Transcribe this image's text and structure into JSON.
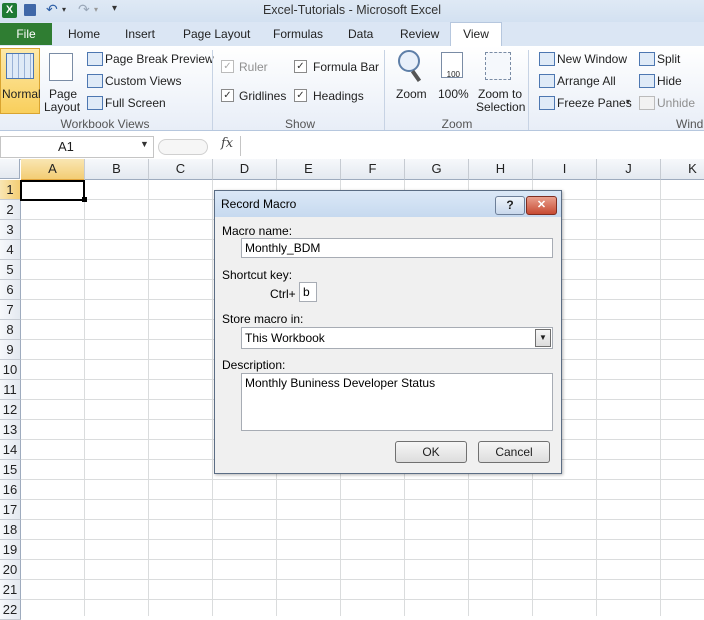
{
  "window": {
    "title": "Excel-Tutorials  -  Microsoft Excel"
  },
  "tabs": [
    "File",
    "Home",
    "Insert",
    "Page Layout",
    "Formulas",
    "Data",
    "Review",
    "View"
  ],
  "ribbon": {
    "workbook_views": {
      "group_label": "Workbook Views",
      "normal": "Normal",
      "page_layout_1": "Page",
      "page_layout_2": "Layout",
      "page_break_preview": "Page Break Preview",
      "custom_views": "Custom Views",
      "full_screen": "Full Screen"
    },
    "show": {
      "group_label": "Show",
      "ruler": "Ruler",
      "formula_bar": "Formula Bar",
      "gridlines": "Gridlines",
      "headings": "Headings",
      "ruler_checked": true,
      "formula_bar_checked": true,
      "gridlines_checked": true,
      "headings_checked": true
    },
    "zoom": {
      "group_label": "Zoom",
      "zoom": "Zoom",
      "hundred": "100%",
      "zoom_sel_1": "Zoom to",
      "zoom_sel_2": "Selection",
      "hundred_icon_text": "100"
    },
    "window": {
      "group_label": "Wind",
      "new_window": "New Window",
      "arrange_all": "Arrange All",
      "freeze_panes": "Freeze Panes",
      "split": "Split",
      "hide": "Hide",
      "unhide": "Unhide"
    }
  },
  "formula_bar": {
    "name_box": "A1",
    "fx": "fx",
    "value": ""
  },
  "grid": {
    "columns": [
      "A",
      "B",
      "C",
      "D",
      "E",
      "F",
      "G",
      "H",
      "I",
      "J",
      "K"
    ],
    "rows": [
      "1",
      "2",
      "3",
      "4",
      "5",
      "6",
      "7",
      "8",
      "9",
      "10",
      "11",
      "12",
      "13",
      "14",
      "15",
      "16",
      "17",
      "18",
      "19",
      "20",
      "21",
      "22"
    ],
    "active_cell": "A1"
  },
  "dialog": {
    "title": "Record Macro",
    "help": "?",
    "close": "✕",
    "macro_name_label": "Macro name:",
    "macro_name_value": "Monthly_BDM",
    "shortcut_label": "Shortcut key:",
    "ctrl_label": "Ctrl+",
    "shortcut_value": "b",
    "store_label": "Store macro in:",
    "store_value": "This Workbook",
    "description_label": "Description:",
    "description_value": "Monthly Buniness Developer Status",
    "ok": "OK",
    "cancel": "Cancel"
  },
  "colors": {
    "accent": "#2f7d32",
    "selection": "#000000",
    "dialog_title": "#c6d9ef"
  }
}
